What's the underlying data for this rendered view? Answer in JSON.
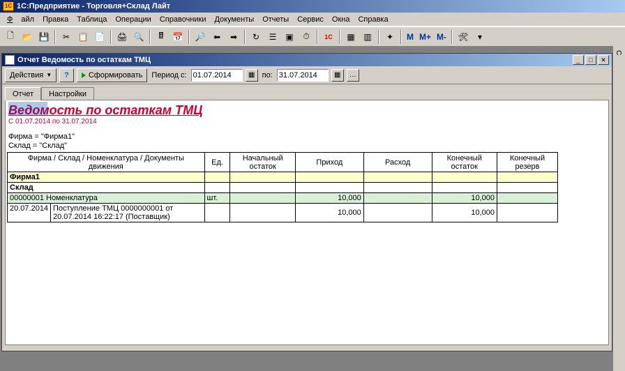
{
  "app": {
    "title": "1С:Предприятие - Торговля+Склад Лайт"
  },
  "menu": {
    "file": "Файл",
    "edit": "Правка",
    "table": "Таблица",
    "ops": "Операции",
    "refs": "Справочники",
    "docs": "Документы",
    "reports": "Отчеты",
    "service": "Сервис",
    "windows": "Окна",
    "help": "Справка"
  },
  "maintb": {
    "m": "М",
    "mplus": "М+",
    "mminus": "М-"
  },
  "report_window": {
    "title": "Отчет  Ведомость по остаткам ТМЦ",
    "actions": "Действия",
    "help": "?",
    "form": "Сформировать",
    "period_from_label": "Период с:",
    "period_from": "01.07.2014",
    "period_to_label": "по:",
    "period_to": "31.07.2014"
  },
  "tabs": {
    "report": "Отчет",
    "settings": "Настройки"
  },
  "report": {
    "title": "Ведомость по остаткам ТМЦ",
    "period": "С 01.07.2014 по 31.07.2014",
    "firm_filter": "Фирма = \"Фирма1\"",
    "sklad_filter": "Склад = \"Склад\"",
    "headers": {
      "c1": "Фирма / Склад / Номенклатура / Документы движения",
      "c2": "Ед.",
      "c3": "Начальный остаток",
      "c4": "Приход",
      "c5": "Расход",
      "c6": "Конечный остаток",
      "c7": "Конечный резерв"
    },
    "firm_row": "Фирма1",
    "sklad_row": "Склад",
    "nomen": {
      "code_name": "00000001 Номенклатура",
      "unit": "шт.",
      "prihod": "10,000",
      "kon_ost": "10,000"
    },
    "doc": {
      "date": "20.07.2014",
      "text": "Поступление ТМЦ 0000000001 от 20.07.2014 16:22:17 (Поставщик)",
      "prihod": "10,000",
      "kon_ost": "10,000"
    }
  },
  "sidetab": "С"
}
